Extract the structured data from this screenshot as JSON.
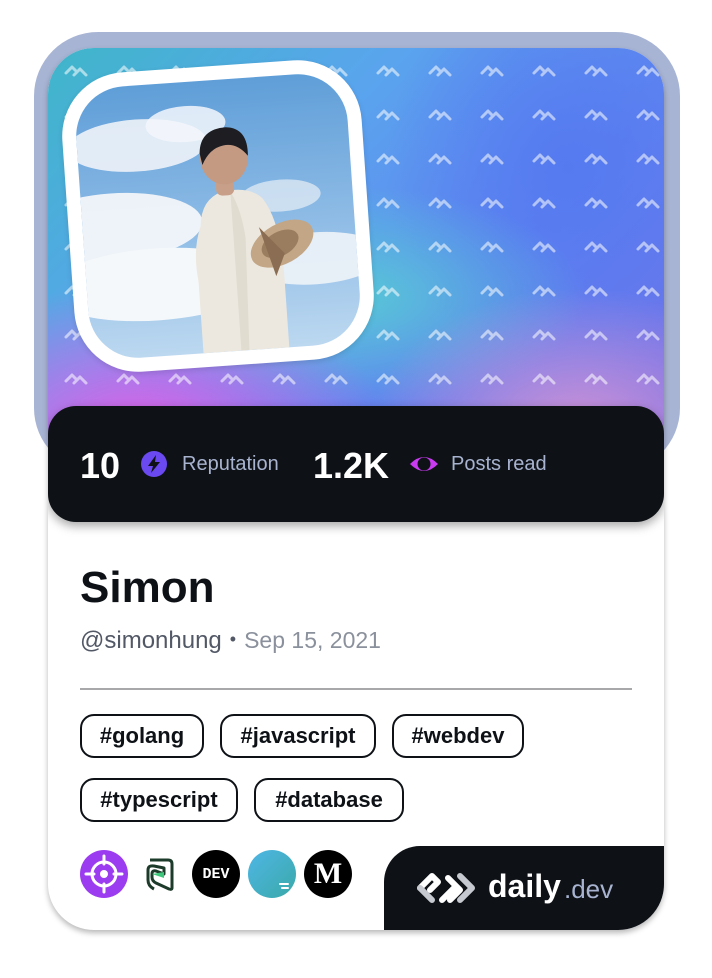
{
  "stats": {
    "reputation_value": "10",
    "reputation_label": "Reputation",
    "posts_value": "1.2K",
    "posts_label": "Posts read"
  },
  "profile": {
    "name": "Simon",
    "handle": "@simonhung",
    "separator": "•",
    "joined": "Sep 15, 2021"
  },
  "tags": [
    "#golang",
    "#javascript",
    "#webdev",
    "#typescript",
    "#database"
  ],
  "sources": [
    "crosshair-source-icon",
    "s-source-icon",
    "DEV",
    "gradient-source-icon",
    "M"
  ],
  "brand": {
    "name": "daily",
    "suffix": ".dev"
  },
  "colors": {
    "dark": "#0e1217",
    "frame": "#a8b4d4",
    "reputation_icon": "#6a4af0",
    "posts_icon": "#c83bf0",
    "stat_label": "#a8b3cf",
    "handle": "#525866",
    "date": "#8b919c"
  }
}
